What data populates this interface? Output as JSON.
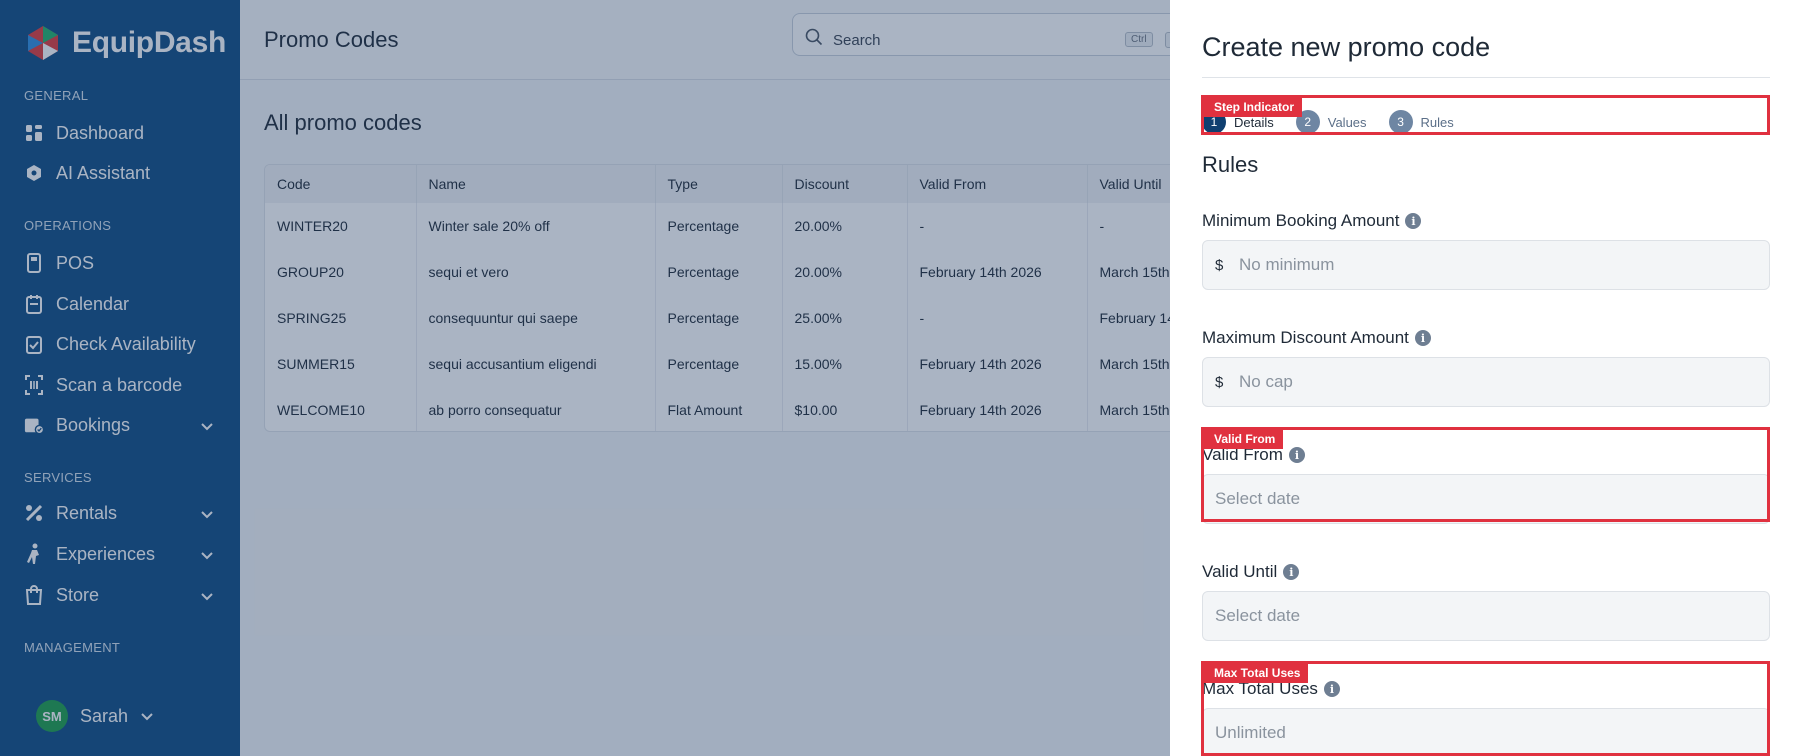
{
  "brand": {
    "name": "EquipDash"
  },
  "sidebar": {
    "sections": [
      "GENERAL",
      "OPERATIONS",
      "SERVICES",
      "MANAGEMENT"
    ],
    "items": [
      {
        "label": "Dashboard",
        "icon": "dashboard-icon"
      },
      {
        "label": "AI Assistant",
        "icon": "ai-assistant-icon"
      },
      {
        "label": "POS",
        "icon": "pos-icon"
      },
      {
        "label": "Calendar",
        "icon": "calendar-icon"
      },
      {
        "label": "Check Availability",
        "icon": "check-availability-icon"
      },
      {
        "label": "Scan a barcode",
        "icon": "barcode-icon"
      },
      {
        "label": "Bookings",
        "icon": "bookings-icon"
      },
      {
        "label": "Rentals",
        "icon": "rentals-icon"
      },
      {
        "label": "Experiences",
        "icon": "experiences-icon"
      },
      {
        "label": "Store",
        "icon": "store-icon"
      }
    ],
    "user": {
      "initials": "SM",
      "name": "Sarah"
    }
  },
  "header": {
    "title": "Promo Codes",
    "search": {
      "placeholder": "Search",
      "shortcut": "Ctrl"
    }
  },
  "table": {
    "title": "All promo codes",
    "columns": [
      "Code",
      "Name",
      "Type",
      "Discount",
      "Valid From",
      "Valid Until"
    ],
    "rows": [
      [
        "WINTER20",
        "Winter sale 20% off",
        "Percentage",
        "20.00%",
        "-",
        "-"
      ],
      [
        "GROUP20",
        "sequi et vero",
        "Percentage",
        "20.00%",
        "February 14th 2026",
        "March 15th"
      ],
      [
        "SPRING25",
        "consequuntur qui saepe",
        "Percentage",
        "25.00%",
        "-",
        "February 14"
      ],
      [
        "SUMMER15",
        "sequi accusantium eligendi",
        "Percentage",
        "15.00%",
        "February 14th 2026",
        "March 15th"
      ],
      [
        "WELCOME10",
        "ab porro consequatur",
        "Flat Amount",
        "$10.00",
        "February 14th 2026",
        "March 15th"
      ]
    ]
  },
  "drawer": {
    "title": "Create new promo code",
    "steps": [
      {
        "num": "1",
        "label": "Details"
      },
      {
        "num": "2",
        "label": "Values"
      },
      {
        "num": "3",
        "label": "Rules"
      }
    ],
    "section_title": "Rules",
    "fields": {
      "min_booking": {
        "label": "Minimum Booking Amount",
        "prefix": "$",
        "placeholder": "No minimum"
      },
      "max_discount": {
        "label": "Maximum Discount Amount",
        "prefix": "$",
        "placeholder": "No cap"
      },
      "valid_from": {
        "label": "Valid From",
        "placeholder": "Select date"
      },
      "valid_until": {
        "label": "Valid Until",
        "placeholder": "Select date"
      },
      "max_uses": {
        "label": "Max Total Uses",
        "placeholder": "Unlimited"
      }
    }
  },
  "annotations": {
    "step_indicator": "Step Indicator",
    "valid_from": "Valid From",
    "max_total_uses": "Max Total Uses"
  },
  "colors": {
    "sidebar": "#0f4d84",
    "accent": "#0f3f70",
    "annotation": "#e0313f",
    "avatar": "#1e9e4a"
  }
}
